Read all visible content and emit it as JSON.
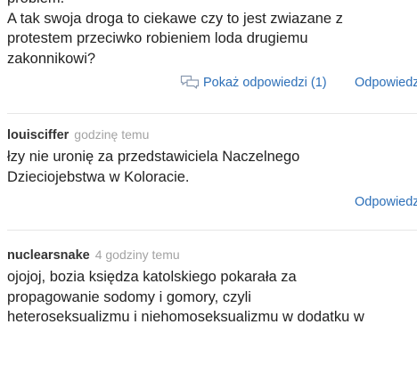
{
  "comments": [
    {
      "lines": [
        "problem.",
        "A tak swoja droga to ciekawe czy to jest zwiazane z",
        "protestem przeciwko robieniem loda drugiemu",
        "zakonnikowi?"
      ],
      "show_replies_label": "Pokaż odpowiedzi (1)",
      "reply_label": "Odpowiedz"
    },
    {
      "author": "louisciffer",
      "time": "godzinę temu",
      "lines": [
        "łzy nie uronię za przedstawiciela Naczelnego",
        "Dzieciojebstwa w Koloracie."
      ],
      "reply_label": "Odpowiedz"
    },
    {
      "author": "nuclearsnake",
      "time": "4 godziny temu",
      "lines": [
        "ojojoj, bozia księdza katolskiego pokarała za",
        "propagowanie sodomy i gomory, czyli",
        "heteroseksualizmu i niehomoseksualizmu w dodatku w"
      ]
    }
  ],
  "colors": {
    "link": "#2c6fb8",
    "meta_time": "#a3a3a3",
    "separator": "#e6e6e6"
  }
}
